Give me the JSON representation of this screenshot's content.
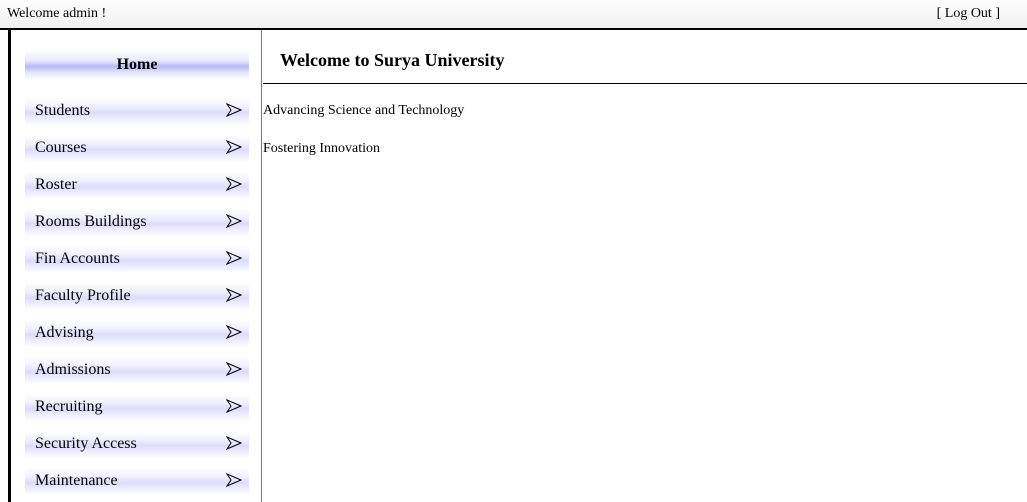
{
  "header": {
    "welcome_text": "Welcome admin !",
    "logout_label": "[ Log Out ]"
  },
  "sidebar": {
    "home_label": "Home",
    "items": [
      {
        "label": "Students"
      },
      {
        "label": "Courses"
      },
      {
        "label": "Roster"
      },
      {
        "label": "Rooms Buildings"
      },
      {
        "label": "Fin Accounts"
      },
      {
        "label": "Faculty Profile"
      },
      {
        "label": "Advising"
      },
      {
        "label": "Admissions"
      },
      {
        "label": "Recruiting"
      },
      {
        "label": "Security Access"
      },
      {
        "label": "Maintenance"
      }
    ],
    "arrow_icon": "chevron-right-outline-icon",
    "accent_color": "#b9b9f5"
  },
  "main": {
    "title": "Welcome to Surya University",
    "lines": [
      "Advancing Science and Technology",
      "Fostering Innovation"
    ]
  }
}
